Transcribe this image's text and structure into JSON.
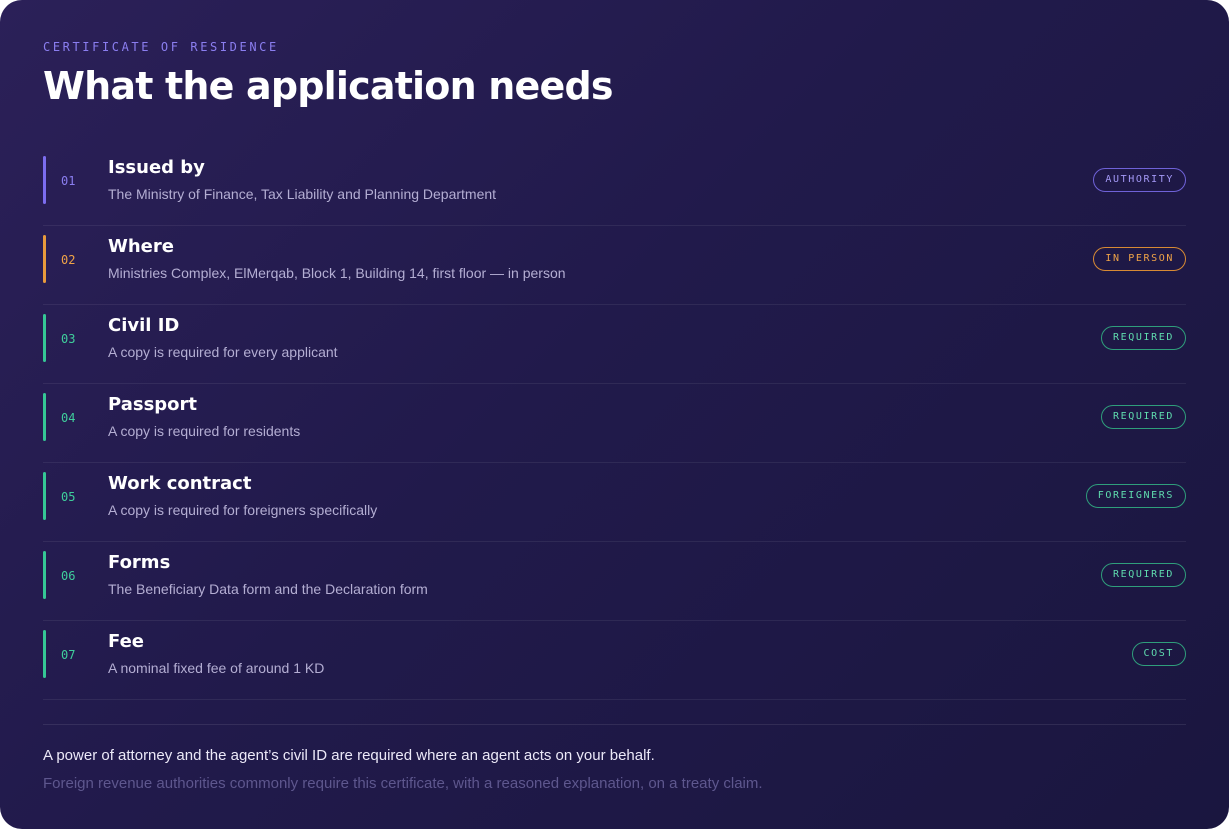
{
  "header": {
    "eyebrow": "CERTIFICATE OF RESIDENCE",
    "title": "What the application needs"
  },
  "items": [
    {
      "number": "01",
      "title": "Issued by",
      "description": "The Ministry of Finance, Tax Liability and Planning Department",
      "tag": "AUTHORITY",
      "accent": "#7c6df0"
    },
    {
      "number": "02",
      "title": "Where",
      "description": "Ministries Complex, ElMerqab, Block 1, Building 14, first floor — in person",
      "tag": "IN PERSON",
      "accent": "#e89a3c"
    },
    {
      "number": "03",
      "title": "Civil ID",
      "description": "A copy is required for every applicant",
      "tag": "REQUIRED",
      "accent": "#35c795"
    },
    {
      "number": "04",
      "title": "Passport",
      "description": "A copy is required for residents",
      "tag": "REQUIRED",
      "accent": "#35c795"
    },
    {
      "number": "05",
      "title": "Work contract",
      "description": "A copy is required for foreigners specifically",
      "tag": "FOREIGNERS",
      "accent": "#35c795"
    },
    {
      "number": "06",
      "title": "Forms",
      "description": "The Beneficiary Data form and the Declaration form",
      "tag": "REQUIRED",
      "accent": "#35c795"
    },
    {
      "number": "07",
      "title": "Fee",
      "description": "A nominal fixed fee of around 1 KD",
      "tag": "COST",
      "accent": "#35c795"
    }
  ],
  "footer": {
    "note": "A power of attorney and the agent’s civil ID are required where an agent acts on your behalf.",
    "subnote": "Foreign revenue authorities commonly require this certificate, with a reasoned explanation, on a treaty claim."
  },
  "colors": {
    "background": "#211a4b",
    "authority": "#7c6df0",
    "in_person": "#e89a3c",
    "requirement": "#35c795"
  }
}
